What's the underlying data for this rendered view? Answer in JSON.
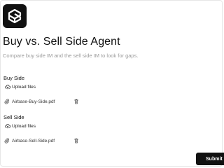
{
  "page": {
    "title": "Buy vs. Sell Side Agent",
    "subtitle": "Compare buy side IM and the sell side IM to look for gaps."
  },
  "logo": {
    "icon": "cube-logo-icon"
  },
  "buy_side": {
    "label": "Buy Side",
    "upload_label": "Upload files",
    "file_name": "Airbase-Buy-Side.pdf"
  },
  "sell_side": {
    "label": "Sell Side",
    "upload_label": "Upload files",
    "file_name": "Airbase-Sell-Side.pdf"
  },
  "submit": {
    "label": "Submit"
  },
  "colors": {
    "primary": "#111111",
    "muted_text": "#9a9a9a",
    "background": "#ffffff"
  }
}
